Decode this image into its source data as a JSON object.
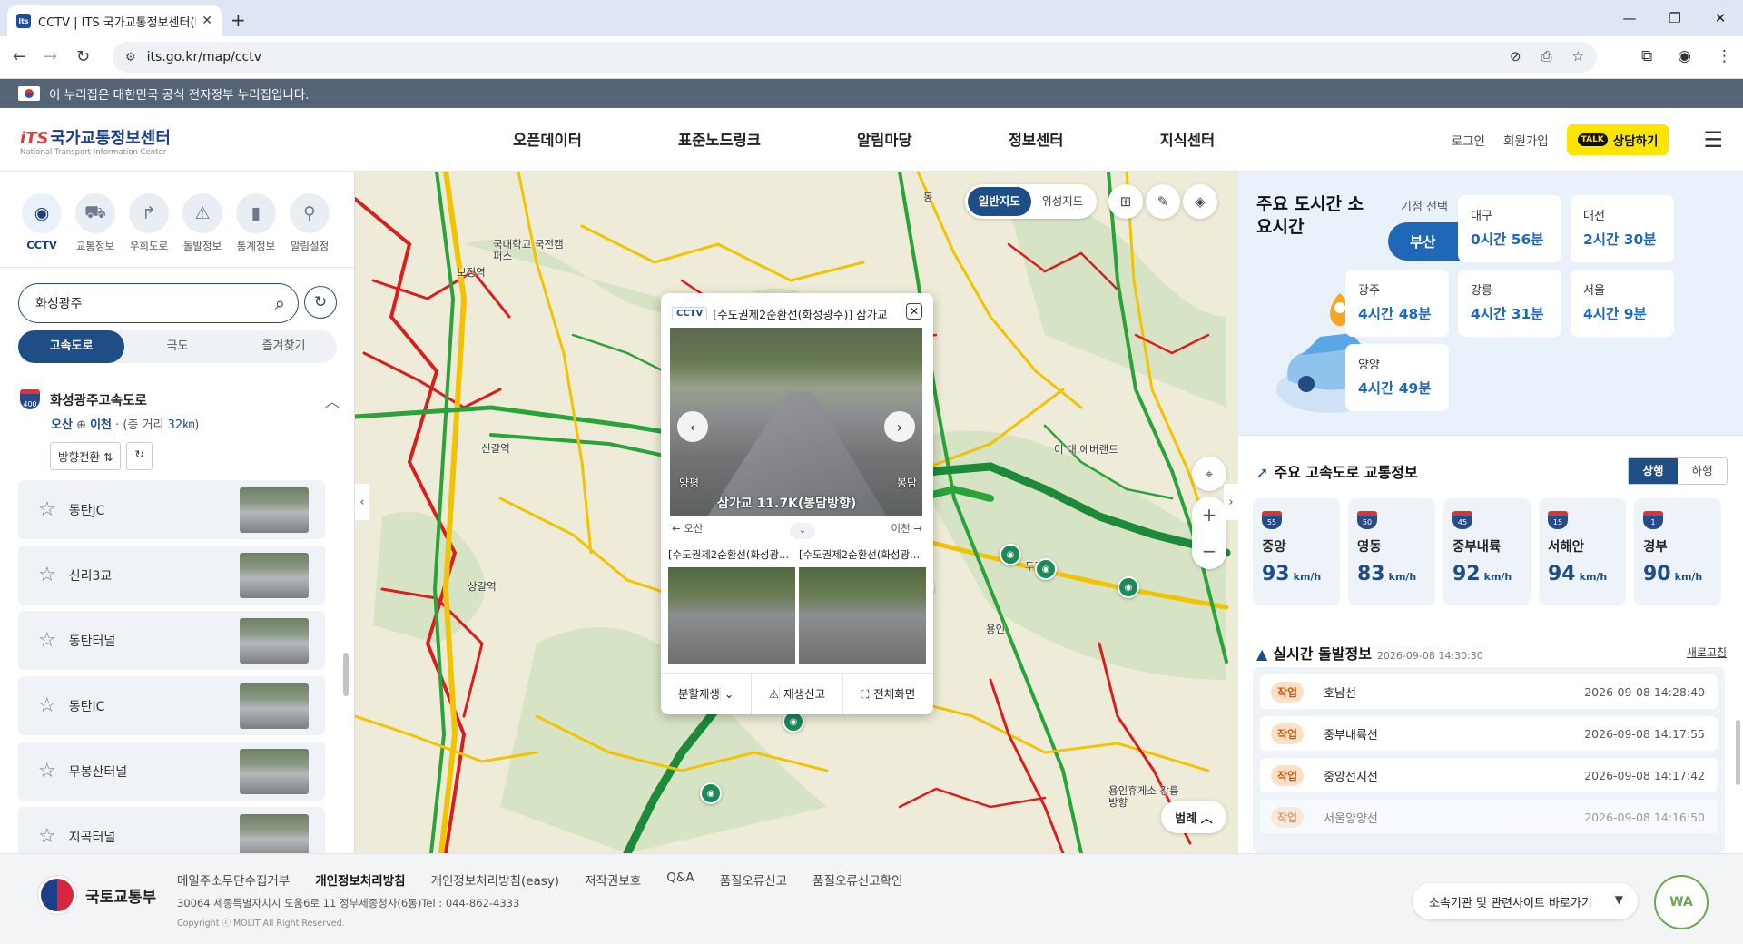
{
  "browser": {
    "tab_title": "CCTV | ITS 국가교통정보센터(N",
    "url": "its.go.kr/map/cctv"
  },
  "gov_banner": "이 누리집은 대한민국 공식 전자정부 누리집입니다.",
  "site": {
    "logo_title": "국가교통정보센터",
    "logo_sub": "National Transport Information Center",
    "nav": [
      "오픈데이터",
      "표준노드링크",
      "알림마당",
      "정보센터",
      "지식센터"
    ],
    "login": "로그인",
    "signup": "회원가입",
    "kakao_badge": "TALK",
    "consult": "상담하기"
  },
  "sidebar": {
    "categories": [
      {
        "label": "CCTV",
        "icon": "cctv-icon"
      },
      {
        "label": "교통정보",
        "icon": "car-icon"
      },
      {
        "label": "우회도로",
        "icon": "detour-icon"
      },
      {
        "label": "돌발정보",
        "icon": "incident-icon"
      },
      {
        "label": "통계정보",
        "icon": "stats-icon"
      },
      {
        "label": "알림설정",
        "icon": "alert-pin-icon"
      }
    ],
    "search_value": "화성광주",
    "tabs": [
      "고속도로",
      "국도",
      "즐겨찾기"
    ],
    "route": {
      "badge": "400",
      "name": "화성광주고속도로",
      "from": "오산",
      "to": "이천",
      "total_prefix": "(총 거리",
      "total_km": "32㎞",
      "total_suffix": ")"
    },
    "direction_btn": "방향전환 ⇅",
    "cameras": [
      "동탄JC",
      "신리3교",
      "동탄터널",
      "동탄IC",
      "무봉산터널",
      "지곡터널"
    ]
  },
  "map": {
    "type_options": [
      "일반지도",
      "위성지도"
    ],
    "labels": [
      "보정역",
      "국대학교 국전캠퍼스",
      "신갈역",
      "상갈역",
      "두전역",
      "용인",
      "용인휴게소 강릉방향",
      "이 대.에버랜드",
      "동"
    ],
    "legend": "범례"
  },
  "popup": {
    "tag": "CCTV",
    "title": "[수도권제2순환선(화성광주)] 삼가교",
    "caption": "삼가교 11.7K(봉담방향)",
    "cap_left": "양평",
    "cap_right": "봉담",
    "dir_left": "← 오산",
    "dir_right": "이천 →",
    "sub1": "[수도권제2순환선(화성광...",
    "sub2": "[수도권제2순환선(화성광...",
    "actions": [
      "분할재생",
      "재생신고",
      "전체화면"
    ]
  },
  "travel": {
    "title": "주요 도시간 소요시간",
    "origin_label": "기점 선택",
    "origin": "부산",
    "cities": [
      {
        "name": "대구",
        "time": "0시간 56분"
      },
      {
        "name": "대전",
        "time": "2시간 30분"
      },
      {
        "name": "광주",
        "time": "4시간 48분"
      },
      {
        "name": "강릉",
        "time": "4시간 31분"
      },
      {
        "name": "서울",
        "time": "4시간 9분"
      },
      {
        "name": "양양",
        "time": "4시간 49분"
      }
    ]
  },
  "highway": {
    "title": "주요 고속도로 교통정보",
    "dir_up": "상행",
    "dir_down": "하행",
    "unit": "km/h",
    "items": [
      {
        "no": "55",
        "name": "중앙",
        "speed": "93"
      },
      {
        "no": "50",
        "name": "영동",
        "speed": "83"
      },
      {
        "no": "45",
        "name": "중부내륙",
        "speed": "92"
      },
      {
        "no": "15",
        "name": "서해안",
        "speed": "94"
      },
      {
        "no": "1",
        "name": "경부",
        "speed": "90"
      }
    ]
  },
  "incidents": {
    "title": "실시간 돌발정보",
    "timestamp": "2026-09-08  14:30:30",
    "refresh": "새로고침",
    "items": [
      {
        "type": "작업",
        "road": "호남선",
        "time": "2026-09-08  14:28:40"
      },
      {
        "type": "작업",
        "road": "중부내륙선",
        "time": "2026-09-08  14:17:55"
      },
      {
        "type": "작업",
        "road": "중앙선지선",
        "time": "2026-09-08  14:17:42"
      },
      {
        "type": "작업",
        "road": "서울양양선",
        "time": "2026-09-08  14:16:50"
      }
    ]
  },
  "footer": {
    "org": "국토교통부",
    "links": [
      "메일주소무단수집거부",
      "개인정보처리방침",
      "개인정보처리방침(easy)",
      "저작권보호",
      "Q&A",
      "품질오류신고",
      "품질오류신고확인"
    ],
    "address": "30064 세종특별자치시 도움6로 11 정부세종청사(6동)Tel : 044-862-4333",
    "copyright": "Copyright ⓒ MOLIT All Right Reserved.",
    "related": "소속기관 및 관련사이트 바로가기",
    "wa_badge": "WA"
  }
}
